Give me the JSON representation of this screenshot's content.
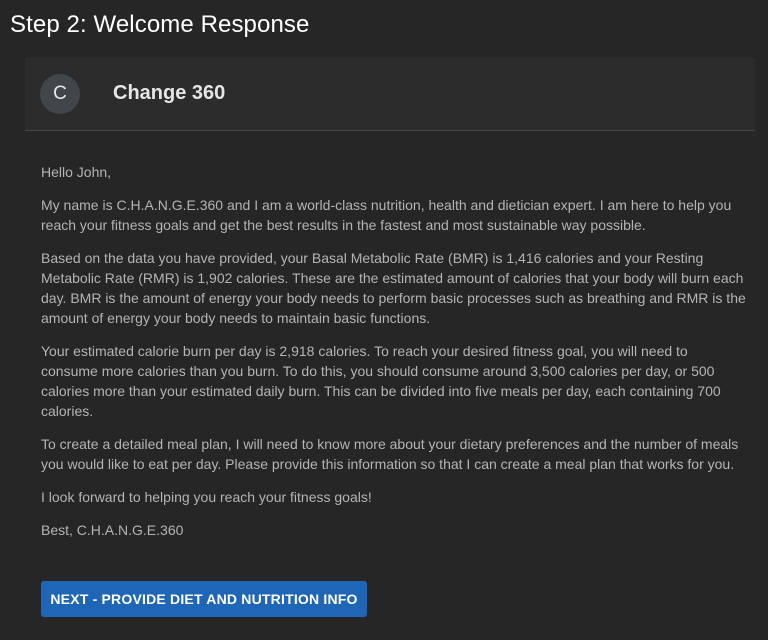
{
  "page": {
    "title": "Step 2: Welcome Response"
  },
  "card": {
    "avatar_initial": "C",
    "title": "Change 360",
    "message": {
      "greeting": "Hello John,",
      "paragraphs": [
        "My name is C.H.A.N.G.E.360 and I am a world-class nutrition, health and dietician expert. I am here to help you reach your fitness goals and get the best results in the fastest and most sustainable way possible.",
        "Based on the data you have provided, your Basal Metabolic Rate (BMR) is 1,416 calories and your Resting Metabolic Rate (RMR) is 1,902 calories. These are the estimated amount of calories that your body will burn each day. BMR is the amount of energy your body needs to perform basic processes such as breathing and RMR is the amount of energy your body needs to maintain basic functions.",
        "Your estimated calorie burn per day is 2,918 calories. To reach your desired fitness goal, you will need to consume more calories than you burn. To do this, you should consume around 3,500 calories per day, or 500 calories more than your estimated daily burn. This can be divided into five meals per day, each containing 700 calories.",
        "To create a detailed meal plan, I will need to know more about your dietary preferences and the number of meals you would like to eat per day. Please provide this information so that I can create a meal plan that works for you.",
        "I look forward to helping you reach your fitness goals!"
      ],
      "signoff": "Best, C.H.A.N.G.E.360"
    },
    "next_button_label": "NEXT - PROVIDE DIET AND NUTRITION INFO"
  },
  "colors": {
    "background": "#262626",
    "header_background": "#2c2c2c",
    "body_text": "#b4b4b4",
    "button": "#1f66b7"
  }
}
